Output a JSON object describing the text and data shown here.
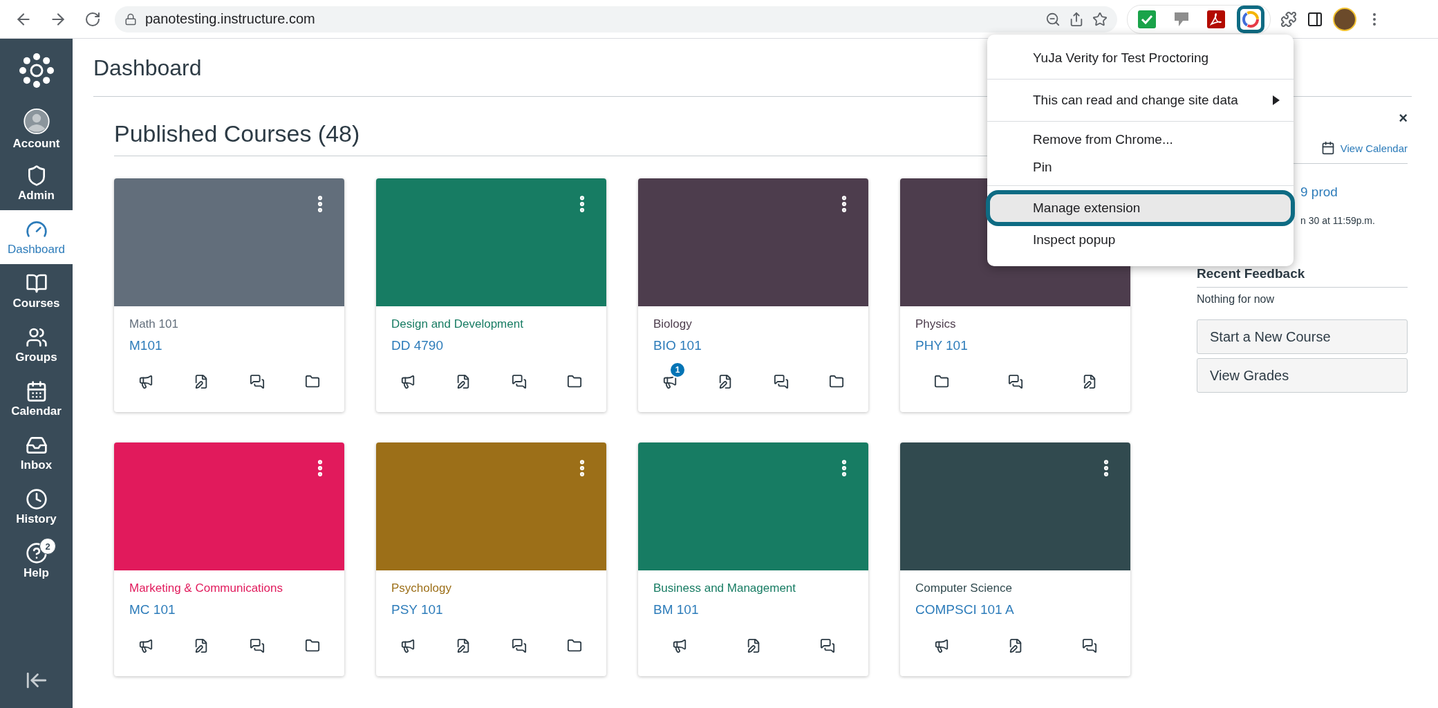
{
  "browser": {
    "url": "panotesting.instructure.com",
    "extensions": [
      {
        "kind": "check",
        "highlighted": false
      },
      {
        "kind": "tag",
        "highlighted": false
      },
      {
        "kind": "pdf",
        "highlighted": false
      },
      {
        "kind": "yuja",
        "highlighted": true
      }
    ]
  },
  "sidebar": {
    "items": [
      {
        "label": "Account",
        "kind": "account",
        "selected": false
      },
      {
        "label": "Admin",
        "kind": "admin",
        "selected": false
      },
      {
        "label": "Dashboard",
        "kind": "dashboard",
        "selected": true
      },
      {
        "label": "Courses",
        "kind": "courses",
        "selected": false
      },
      {
        "label": "Groups",
        "kind": "groups",
        "selected": false
      },
      {
        "label": "Calendar",
        "kind": "calendar",
        "selected": false
      },
      {
        "label": "Inbox",
        "kind": "inbox",
        "selected": false
      },
      {
        "label": "History",
        "kind": "history",
        "selected": false
      },
      {
        "label": "Help",
        "kind": "help",
        "selected": false,
        "badge": "2"
      }
    ]
  },
  "header": {
    "title": "Dashboard"
  },
  "courses": {
    "heading": "Published Courses (48)",
    "cards": [
      {
        "name": "Math 101",
        "code": "M101",
        "color": "#626e7b",
        "more_button": true,
        "actions": [
          {
            "kind": "announcements"
          },
          {
            "kind": "assignments"
          },
          {
            "kind": "discussions"
          },
          {
            "kind": "files"
          }
        ]
      },
      {
        "name": "Design and Development",
        "code": "DD 4790",
        "color": "#177c63",
        "more_button": true,
        "actions": [
          {
            "kind": "announcements"
          },
          {
            "kind": "assignments"
          },
          {
            "kind": "discussions"
          },
          {
            "kind": "files"
          }
        ]
      },
      {
        "name": "Biology",
        "code": "BIO 101",
        "color": "#4d3d4d",
        "more_button": true,
        "actions": [
          {
            "kind": "announcements",
            "badge": "1"
          },
          {
            "kind": "assignments"
          },
          {
            "kind": "discussions"
          },
          {
            "kind": "files"
          }
        ]
      },
      {
        "name": "Physics",
        "code": "PHY 101",
        "color": "#4d3d4d",
        "actions": [
          {
            "kind": "files"
          },
          {
            "kind": "discussions"
          },
          {
            "kind": "assignments"
          }
        ]
      },
      {
        "name": "Marketing & Communications",
        "code": "MC 101",
        "color": "#e11a5c",
        "more_button": true,
        "actions": [
          {
            "kind": "announcements"
          },
          {
            "kind": "assignments"
          },
          {
            "kind": "discussions"
          },
          {
            "kind": "files"
          }
        ]
      },
      {
        "name": "Psychology",
        "code": "PSY 101",
        "color": "#9c6f18",
        "more_button": true,
        "actions": [
          {
            "kind": "announcements"
          },
          {
            "kind": "assignments"
          },
          {
            "kind": "discussions"
          },
          {
            "kind": "files"
          }
        ]
      },
      {
        "name": "Business and Management",
        "code": "BM 101",
        "color": "#177c63",
        "more_button": true,
        "actions": [
          {
            "kind": "announcements"
          },
          {
            "kind": "assignments"
          },
          {
            "kind": "discussions"
          }
        ]
      },
      {
        "name": "Computer Science",
        "code": "COMPSCI 101 A",
        "color": "#314a4f",
        "more_button": true,
        "actions": [
          {
            "kind": "announcements"
          },
          {
            "kind": "assignments"
          },
          {
            "kind": "discussions"
          }
        ]
      }
    ]
  },
  "right_panel": {
    "close": "×",
    "view_calendar": "View Calendar",
    "todo_link": "9 prod",
    "todo_due": "n 30 at 11:59p.m.",
    "feedback_heading": "Recent Feedback",
    "feedback_empty": "Nothing for now",
    "buttons": [
      "Start a New Course",
      "View Grades"
    ]
  },
  "extension_menu": {
    "groups": [
      [
        {
          "label": "YuJa Verity for Test Proctoring",
          "kind": "title",
          "highlighted": false
        }
      ],
      [
        {
          "label": "This can read and change site data",
          "kind": "submenu",
          "highlighted": false
        }
      ],
      [
        {
          "label": "Remove from Chrome...",
          "kind": "item",
          "highlighted": false
        },
        {
          "label": "Pin",
          "kind": "item",
          "highlighted": false
        }
      ],
      [
        {
          "label": "Manage extension",
          "kind": "item",
          "highlighted": true
        },
        {
          "label": "Inspect popup",
          "kind": "item",
          "highlighted": false
        }
      ]
    ]
  }
}
